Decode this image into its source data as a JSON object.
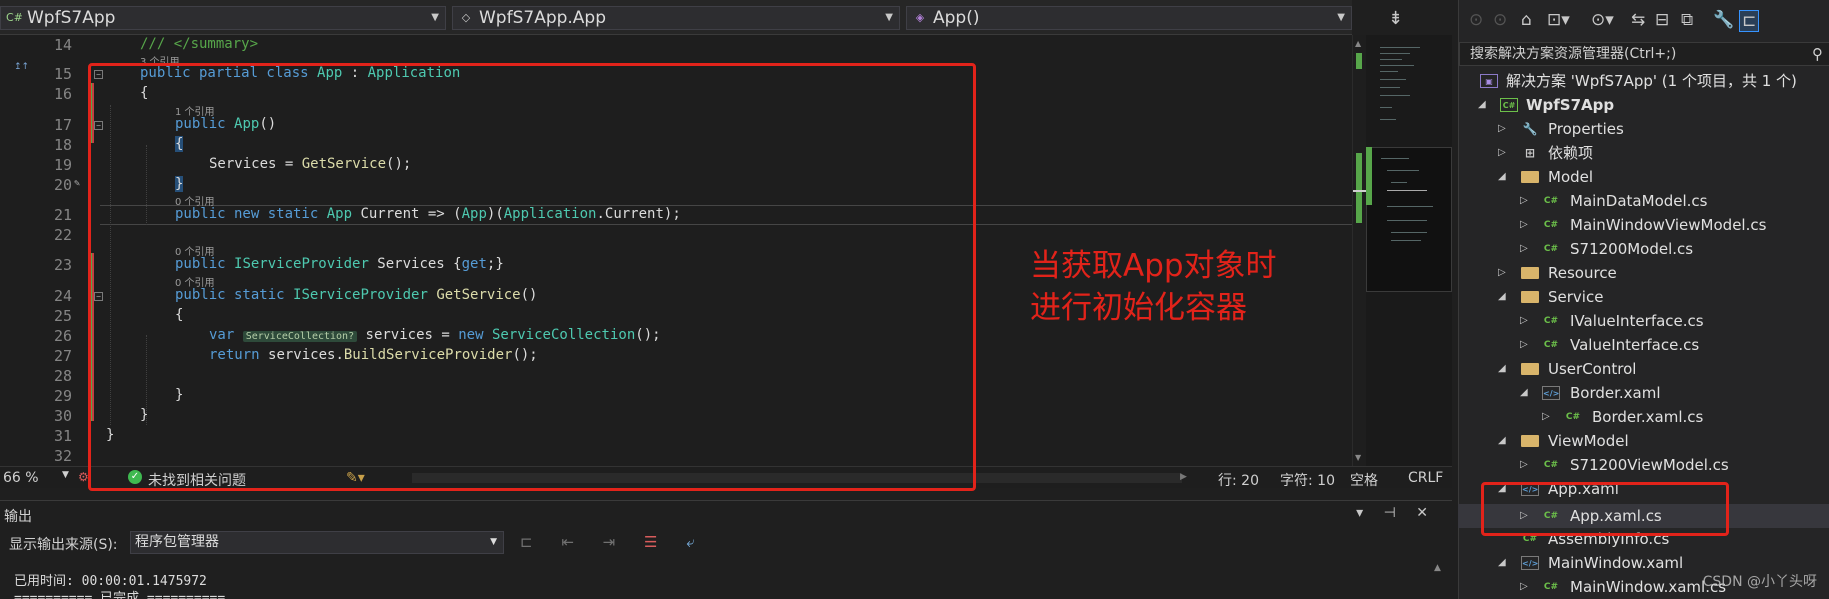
{
  "navbar": {
    "project_dropdown": "WpfS7App",
    "class_dropdown": "WpfS7App.App",
    "member_dropdown": "App()"
  },
  "editor": {
    "lines": [
      {
        "num": "14"
      },
      {
        "num": "15"
      },
      {
        "num": "16"
      },
      {
        "num": "17"
      },
      {
        "num": "18"
      },
      {
        "num": "19"
      },
      {
        "num": "20"
      },
      {
        "num": "21"
      },
      {
        "num": "22"
      },
      {
        "num": "23"
      },
      {
        "num": "24"
      },
      {
        "num": "25"
      },
      {
        "num": "26"
      },
      {
        "num": "27"
      },
      {
        "num": "28"
      },
      {
        "num": "29"
      },
      {
        "num": "30"
      },
      {
        "num": "31"
      },
      {
        "num": "32"
      }
    ],
    "code": {
      "l14": "/// </summary>",
      "lens_3": "3 个引用",
      "l15_kw": "public partial class ",
      "l15_type": "App",
      "l15_sep": " : ",
      "l15_base": "Application",
      "l16": "{",
      "lens_1": "1 个引用",
      "l17_kw": "public ",
      "l17_fn": "App",
      "l17_rest": "()",
      "l18": "{",
      "l19_a": "Services = ",
      "l19_fn": "GetService",
      "l19_b": "();",
      "l20": "}",
      "lens_0a": "0 个引用",
      "l21_kw": "public new static ",
      "l21_type": "App",
      "l21_a": " Current => (",
      "l21_type2": "App",
      "l21_b": ")(",
      "l21_type3": "Application",
      "l21_c": ".Current);",
      "lens_0b": "0 个引用",
      "l23_kw": "public ",
      "l23_type": "IServiceProvider",
      "l23_a": " Services {",
      "l23_kw2": "get",
      "l23_b": ";}",
      "lens_0c": "0 个引用",
      "l24_kw": "public static ",
      "l24_type": "IServiceProvider",
      "l24_sp": " ",
      "l24_fn": "GetService",
      "l24_b": "()",
      "l25": "{",
      "l26_kw": "var ",
      "l26_hint": "ServiceCollection?",
      "l26_a": " services = ",
      "l26_kw2": "new ",
      "l26_type": "ServiceCollection",
      "l26_b": "();",
      "l27_kw": "return ",
      "l27_a": "services.",
      "l27_fn": "BuildServiceProvider",
      "l27_b": "();",
      "l29": "}",
      "l30": "}",
      "l31": "}"
    }
  },
  "status": {
    "zoom": "66 %",
    "issues": "未找到相关问题",
    "line": "行: 20",
    "col": "字符: 10",
    "spaces": "空格",
    "eol": "CRLF"
  },
  "output": {
    "title": "输出",
    "source_label": "显示输出来源(S):",
    "source_value": "程序包管理器",
    "text_line1": "已用时间: 00:00:01.1475972",
    "text_line2": "========== 已完成 =========="
  },
  "solution_explorer": {
    "search_placeholder": "搜索解决方案资源管理器(Ctrl+;)",
    "items": [
      {
        "label": "解决方案 'WpfS7App' (1 个项目，共 1 个)",
        "icon": "solution-icon"
      },
      {
        "label": "WpfS7App",
        "icon": "csharp-project-icon"
      },
      {
        "label": "Properties",
        "icon": "properties-icon"
      },
      {
        "label": "依赖项",
        "icon": "dependencies-icon"
      },
      {
        "label": "Model",
        "icon": "folder-icon"
      },
      {
        "label": "MainDataModel.cs",
        "icon": "csharp-file-icon"
      },
      {
        "label": "MainWindowViewModel.cs",
        "icon": "csharp-file-icon"
      },
      {
        "label": "S71200Model.cs",
        "icon": "csharp-file-icon"
      },
      {
        "label": "Resource",
        "icon": "folder-icon"
      },
      {
        "label": "Service",
        "icon": "folder-icon"
      },
      {
        "label": "IValueInterface.cs",
        "icon": "csharp-file-icon"
      },
      {
        "label": "ValueInterface.cs",
        "icon": "csharp-file-icon"
      },
      {
        "label": "UserControl",
        "icon": "folder-icon"
      },
      {
        "label": "Border.xaml",
        "icon": "xaml-file-icon"
      },
      {
        "label": "Border.xaml.cs",
        "icon": "csharp-file-icon"
      },
      {
        "label": "ViewModel",
        "icon": "folder-icon"
      },
      {
        "label": "S71200ViewModel.cs",
        "icon": "csharp-file-icon"
      },
      {
        "label": "App.xaml",
        "icon": "xaml-file-icon"
      },
      {
        "label": "App.xaml.cs",
        "icon": "csharp-file-icon"
      },
      {
        "label": "AssemblyInfo.cs",
        "icon": "csharp-file-icon"
      },
      {
        "label": "MainWindow.xaml",
        "icon": "xaml-file-icon"
      },
      {
        "label": "MainWindow.xaml.cs",
        "icon": "csharp-file-icon"
      }
    ]
  },
  "annotation": {
    "line1": "当获取App对象时",
    "line2": "进行初始化容器"
  },
  "watermark": "CSDN @小丫头呀",
  "colors": {
    "annotation_red": "#e2231a",
    "keyword": "#569cd6",
    "type": "#4ec9b0",
    "method": "#dcdcaa",
    "comment": "#57a64a"
  }
}
